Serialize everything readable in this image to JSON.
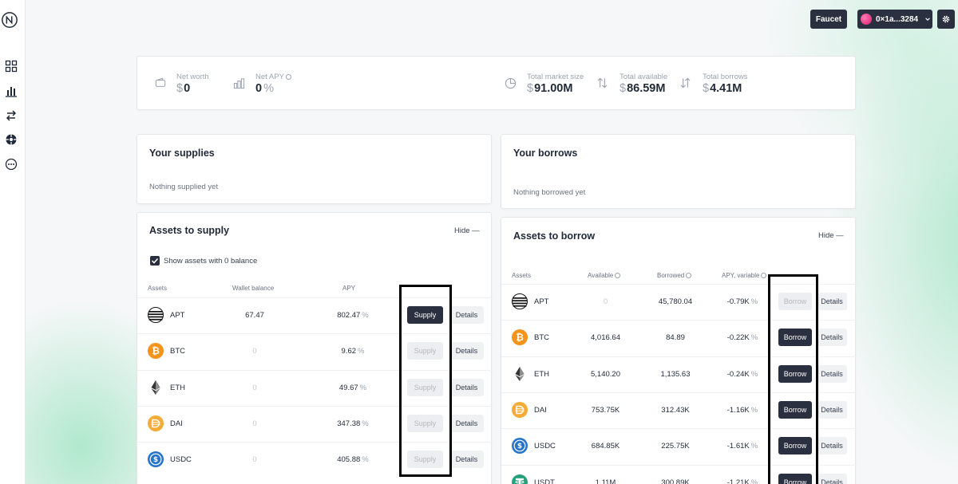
{
  "header": {
    "faucet_label": "Faucet",
    "wallet_address": "0×1a...3284"
  },
  "stats": {
    "net_worth": {
      "label": "Net worth",
      "currency": "$",
      "value": "0"
    },
    "net_apy": {
      "label": "Net APY",
      "value": "0",
      "unit": "%"
    },
    "total_market_size": {
      "label": "Total market size",
      "currency": "$",
      "value": "91.00M"
    },
    "total_available": {
      "label": "Total available",
      "currency": "$",
      "value": "86.59M"
    },
    "total_borrows": {
      "label": "Total borrows",
      "currency": "$",
      "value": "4.41M"
    }
  },
  "supplies": {
    "title": "Your supplies",
    "empty_text": "Nothing supplied yet"
  },
  "borrows": {
    "title": "Your borrows",
    "empty_text": "Nothing borrowed yet"
  },
  "assets_to_supply": {
    "title": "Assets to supply",
    "hide_label": "Hide —",
    "show_zero_label": "Show assets with 0 balance",
    "show_zero_checked": true,
    "columns": [
      "Assets",
      "Wallet balance",
      "APY"
    ],
    "supply_label": "Supply",
    "details_label": "Details",
    "rows": [
      {
        "symbol": "APT",
        "icon": "apt-icon",
        "balance": "67.47",
        "apy": "802.47",
        "apy_unit": "%",
        "supply_enabled": true
      },
      {
        "symbol": "BTC",
        "icon": "btc-icon",
        "balance": "0",
        "apy": "9.62",
        "apy_unit": "%",
        "supply_enabled": false
      },
      {
        "symbol": "ETH",
        "icon": "eth-icon",
        "balance": "0",
        "apy": "49.67",
        "apy_unit": "%",
        "supply_enabled": false
      },
      {
        "symbol": "DAI",
        "icon": "dai-icon",
        "balance": "0",
        "apy": "347.38",
        "apy_unit": "%",
        "supply_enabled": false
      },
      {
        "symbol": "USDC",
        "icon": "usdc-icon",
        "balance": "0",
        "apy": "405.88",
        "apy_unit": "%",
        "supply_enabled": false
      }
    ]
  },
  "assets_to_borrow": {
    "title": "Assets to borrow",
    "hide_label": "Hide —",
    "columns": [
      "Assets",
      "Available",
      "Borrowed",
      "APY, variable"
    ],
    "borrow_label": "Borrow",
    "details_label": "Details",
    "rows": [
      {
        "symbol": "APT",
        "icon": "apt-icon",
        "available": "0",
        "borrowed": "45,780.04",
        "apy": "-0.79K",
        "apy_unit": "%",
        "borrow_enabled": false
      },
      {
        "symbol": "BTC",
        "icon": "btc-icon",
        "available": "4,016.64",
        "borrowed": "84.89",
        "apy": "-0.22K",
        "apy_unit": "%",
        "borrow_enabled": true
      },
      {
        "symbol": "ETH",
        "icon": "eth-icon",
        "available": "5,140.20",
        "borrowed": "1,135.63",
        "apy": "-0.24K",
        "apy_unit": "%",
        "borrow_enabled": true
      },
      {
        "symbol": "DAI",
        "icon": "dai-icon",
        "available": "753.75K",
        "borrowed": "312.43K",
        "apy": "-1.16K",
        "apy_unit": "%",
        "borrow_enabled": true
      },
      {
        "symbol": "USDC",
        "icon": "usdc-icon",
        "available": "684.85K",
        "borrowed": "225.75K",
        "apy": "-1.61K",
        "apy_unit": "%",
        "borrow_enabled": true
      },
      {
        "symbol": "USDT",
        "icon": "usdt-icon",
        "available": "1.11M",
        "borrowed": "300.89K",
        "apy": "-1.21K",
        "apy_unit": "%",
        "borrow_enabled": true
      }
    ]
  },
  "colors": {
    "primary_dark": "#2b3040",
    "btc": "#f7931a",
    "dai": "#f5ac37",
    "usdc": "#2775ca",
    "usdt": "#26a17b",
    "accent_glow": "#78dcaa"
  }
}
